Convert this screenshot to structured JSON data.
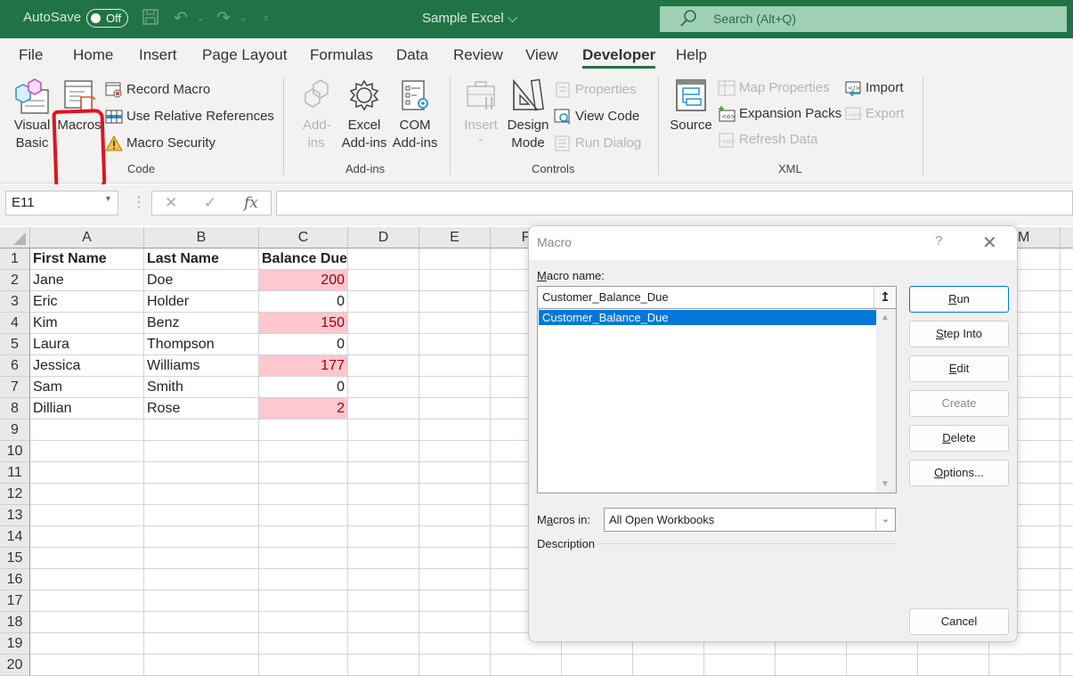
{
  "titlebar": {
    "autosave_label": "AutoSave",
    "autosave_state": "Off",
    "doc_title": "Sample Excel",
    "search_placeholder": "Search (Alt+Q)",
    "colors": {
      "bar": "#217346",
      "search": "#9fcfb4"
    }
  },
  "ribbon": {
    "tabs": [
      {
        "label": "File"
      },
      {
        "label": "Home"
      },
      {
        "label": "Insert"
      },
      {
        "label": "Page Layout"
      },
      {
        "label": "Formulas"
      },
      {
        "label": "Data"
      },
      {
        "label": "Review"
      },
      {
        "label": "View"
      },
      {
        "label": "Developer",
        "active": true
      },
      {
        "label": "Help"
      }
    ],
    "groups": {
      "code": {
        "label": "Code",
        "visual_basic": "Visual Basic",
        "macros": "Macros",
        "record_macro": "Record Macro",
        "relative_refs": "Use Relative References",
        "macro_security": "Macro Security"
      },
      "addins": {
        "label": "Add-ins",
        "addins": "Add-ins",
        "excel_addins": "Excel Add-ins",
        "com_addins": "COM Add-ins"
      },
      "controls": {
        "label": "Controls",
        "insert": "Insert",
        "design_mode": "Design Mode",
        "properties": "Properties",
        "view_code": "View Code",
        "run_dialog": "Run Dialog"
      },
      "xml": {
        "label": "XML",
        "source": "Source",
        "map_properties": "Map Properties",
        "expansion_packs": "Expansion Packs",
        "refresh_data": "Refresh Data",
        "import": "Import",
        "export": "Export"
      }
    }
  },
  "formula_bar": {
    "name_box": "E11",
    "formula": "",
    "fx_label": "fx"
  },
  "sheet": {
    "columns": [
      "A",
      "B",
      "C",
      "D",
      "E",
      "F",
      "M"
    ],
    "row_numbers": [
      1,
      2,
      3,
      4,
      5,
      6,
      7,
      8,
      9,
      10,
      11,
      12,
      13,
      14,
      15,
      16,
      17,
      18,
      19,
      20
    ],
    "headers": {
      "a": "First Name",
      "b": "Last Name",
      "c": "Balance Due"
    },
    "rows": [
      {
        "first": "Jane",
        "last": "Doe",
        "balance": "200",
        "highlight": true
      },
      {
        "first": "Eric",
        "last": "Holder",
        "balance": "0",
        "highlight": false
      },
      {
        "first": "Kim",
        "last": "Benz",
        "balance": "150",
        "highlight": true
      },
      {
        "first": "Laura",
        "last": "Thompson",
        "balance": "0",
        "highlight": false
      },
      {
        "first": "Jessica",
        "last": "Williams",
        "balance": "177",
        "highlight": true
      },
      {
        "first": "Sam",
        "last": "Smith",
        "balance": "0",
        "highlight": false
      },
      {
        "first": "Dillian",
        "last": "Rose",
        "balance": "2",
        "highlight": true
      }
    ],
    "highlight_colors": {
      "fill": "#ffc7ce",
      "text": "#9c0006"
    }
  },
  "dialog": {
    "title": "Macro",
    "help": "?",
    "macro_name_label": "Macro name:",
    "macro_name_value": "Customer_Balance_Due",
    "macro_list": [
      "Customer_Balance_Due"
    ],
    "selected_macro": "Customer_Balance_Due",
    "buttons": {
      "run": "Run",
      "step_into": "Step Into",
      "edit": "Edit",
      "create": "Create",
      "delete": "Delete",
      "options": "Options...",
      "cancel": "Cancel"
    },
    "macros_in_label": "Macros in:",
    "macros_in_value": "All Open Workbooks",
    "description_label": "Description"
  }
}
